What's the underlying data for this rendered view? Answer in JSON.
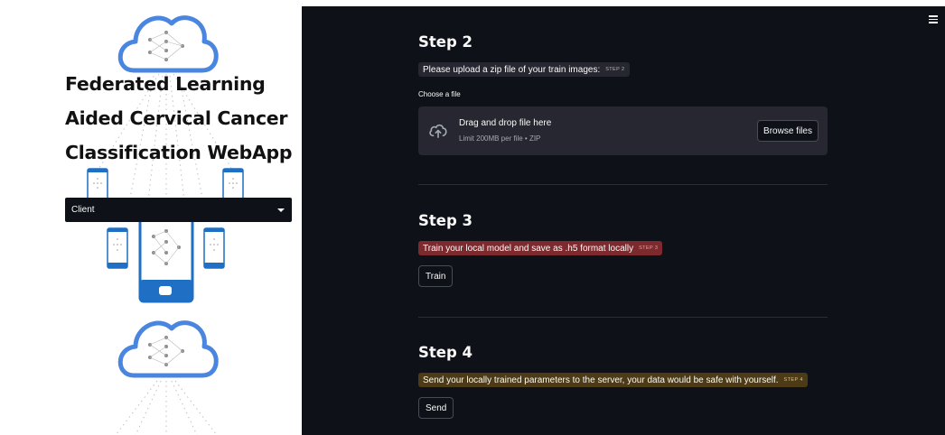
{
  "sidebar": {
    "title_lines": [
      "Federated Learning",
      "Aided Cervical Cancer",
      "Classification WebApp"
    ],
    "select": {
      "value": "Client"
    }
  },
  "main": {
    "step2": {
      "heading": "Step 2",
      "pill_text": "Please upload a zip file of your train images:",
      "pill_tag": "STEP 2",
      "uploader_label": "Choose a file",
      "dropzone_title": "Drag and drop file here",
      "dropzone_subtitle": "Limit 200MB per file • ZIP",
      "browse_label": "Browse files"
    },
    "step3": {
      "heading": "Step 3",
      "pill_text": "Train your local model and save as .h5 format locally",
      "pill_tag": "STEP 3",
      "button_label": "Train"
    },
    "step4": {
      "heading": "Step 4",
      "pill_text": "Send your locally trained parameters to the server, your data would be safe with yourself.",
      "pill_tag": "STEP 4",
      "button_label": "Send"
    }
  },
  "colors": {
    "main_bg": "#0e1117",
    "pill_red": "#7d2a2f",
    "pill_brown": "#4d3b17",
    "cloud_blue": "#4a86e0",
    "phone_blue": "#1f6fc4"
  }
}
